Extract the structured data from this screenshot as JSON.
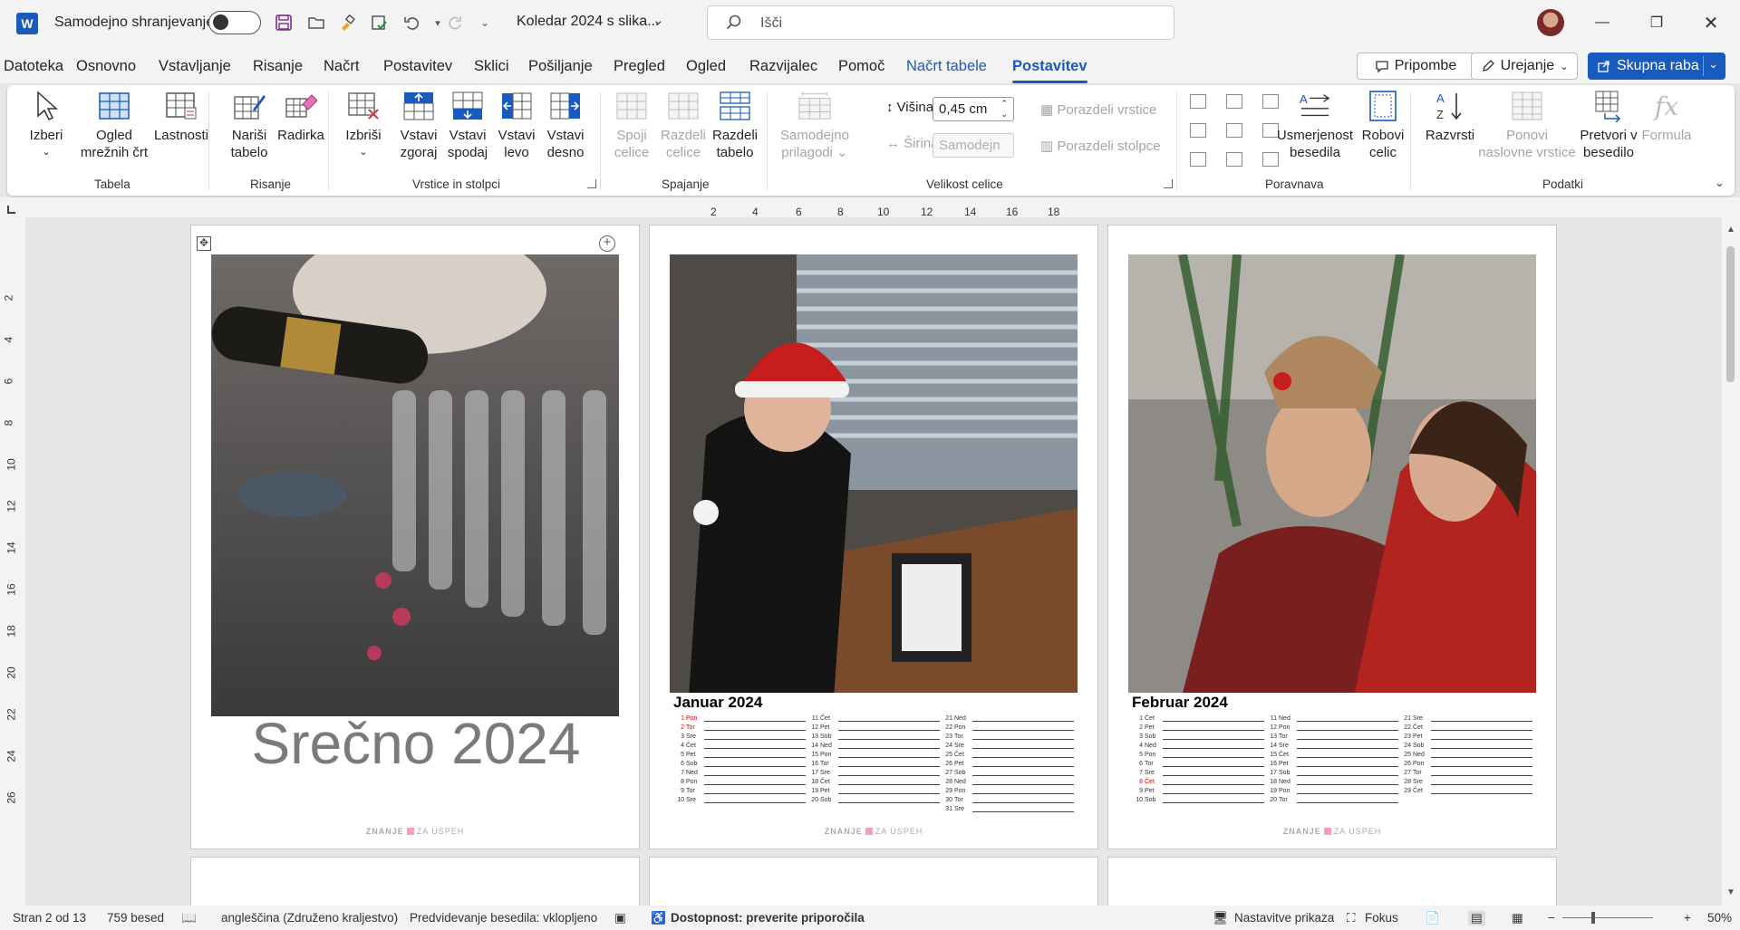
{
  "titlebar": {
    "app_logo": "W",
    "autosave_label": "Samodejno shranjevanje",
    "doc_title": "Koledar 2024 s slika...",
    "search_placeholder": "Išči",
    "icons": [
      "save-icon",
      "open-folder-icon",
      "format-painter-icon",
      "check-icon",
      "undo-icon",
      "redo-icon",
      "more-icon"
    ]
  },
  "menu": {
    "tabs": [
      "Datoteka",
      "Osnovno",
      "Vstavljanje",
      "Risanje",
      "Načrt",
      "Postavitev",
      "Sklici",
      "Pošiljanje",
      "Pregled",
      "Ogled",
      "Razvijalec",
      "Pomoč"
    ],
    "context_tabs": [
      "Načrt tabele",
      "Postavitev"
    ],
    "comments": "Pripombe",
    "editing": "Urejanje",
    "share": "Skupna raba",
    "accent": "#185abd"
  },
  "ribbon": {
    "groups": {
      "table": "Tabela",
      "draw": "Risanje",
      "rows_cols": "Vrstice in stolpci",
      "merge": "Spajanje",
      "cell_size": "Velikost celice",
      "alignment": "Poravnava",
      "data": "Podatki"
    },
    "buttons": {
      "select": "Izberi",
      "gridlines1": "Ogled",
      "gridlines2": "mrežnih črt",
      "properties": "Lastnosti",
      "draw1": "Nariši",
      "draw2": "tabelo",
      "eraser": "Radirka",
      "delete": "Izbriši",
      "ins_above1": "Vstavi",
      "ins_above2": "zgoraj",
      "ins_below1": "Vstavi",
      "ins_below2": "spodaj",
      "ins_left1": "Vstavi",
      "ins_left2": "levo",
      "ins_right1": "Vstavi",
      "ins_right2": "desno",
      "merge1": "Spoji",
      "merge2": "celice",
      "split_cells1": "Razdeli",
      "split_cells2": "celice",
      "split_table1": "Razdeli",
      "split_table2": "tabelo",
      "autofit1": "Samodejno",
      "autofit2": "prilagodi",
      "height_label": "Višina:",
      "height_value": "0,45 cm",
      "width_label": "Širina:",
      "width_value": "Samodejn",
      "dist_rows": "Porazdeli vrstice",
      "dist_cols": "Porazdeli stolpce",
      "text_dir1": "Usmerjenost",
      "text_dir2": "besedila",
      "margins1": "Robovi",
      "margins2": "celic",
      "sort": "Razvrsti",
      "repeat1": "Ponovi",
      "repeat2": "naslovne vrstice",
      "convert1": "Pretvori v",
      "convert2": "besedilo",
      "formula": "Formula"
    }
  },
  "ruler": {
    "h_numbers": [
      "2",
      "4",
      "6",
      "8",
      "10",
      "12",
      "14",
      "16",
      "18"
    ],
    "v_numbers": [
      "2",
      "4",
      "6",
      "8",
      "10",
      "12",
      "14",
      "16",
      "18",
      "20",
      "22",
      "24",
      "26"
    ]
  },
  "pages": {
    "cover_text": "Srečno 2024",
    "january_title": "Januar 2024",
    "february_title": "Februar 2024",
    "footer_brand": "ZNANJE",
    "footer_brand2": "ZA USPEH",
    "january": {
      "col1": [
        [
          "1",
          "Pon",
          true
        ],
        [
          "2",
          "Tor",
          true
        ],
        [
          "3",
          "Sre",
          false
        ],
        [
          "4",
          "Čet",
          false
        ],
        [
          "5",
          "Pet",
          false
        ],
        [
          "6",
          "Sob",
          false
        ],
        [
          "7",
          "Ned",
          false
        ],
        [
          "8",
          "Pon",
          false
        ],
        [
          "9",
          "Tor",
          false
        ],
        [
          "10",
          "Sre",
          false
        ]
      ],
      "col2": [
        [
          "11",
          "Čet",
          false
        ],
        [
          "12",
          "Pet",
          false
        ],
        [
          "13",
          "Sob",
          false
        ],
        [
          "14",
          "Ned",
          false
        ],
        [
          "15",
          "Pon",
          false
        ],
        [
          "16",
          "Tor",
          false
        ],
        [
          "17",
          "Sre",
          false
        ],
        [
          "18",
          "Čet",
          false
        ],
        [
          "19",
          "Pet",
          false
        ],
        [
          "20",
          "Sob",
          false
        ]
      ],
      "col3": [
        [
          "21",
          "Ned",
          false
        ],
        [
          "22",
          "Pon",
          false
        ],
        [
          "23",
          "Tor",
          false
        ],
        [
          "24",
          "Sre",
          false
        ],
        [
          "25",
          "Čet",
          false
        ],
        [
          "26",
          "Pet",
          false
        ],
        [
          "27",
          "Sob",
          false
        ],
        [
          "28",
          "Ned",
          false
        ],
        [
          "29",
          "Pon",
          false
        ],
        [
          "30",
          "Tor",
          false
        ],
        [
          "31",
          "Sre",
          false
        ]
      ]
    },
    "february": {
      "col1": [
        [
          "1",
          "Čet",
          false
        ],
        [
          "2",
          "Pet",
          false
        ],
        [
          "3",
          "Sob",
          false
        ],
        [
          "4",
          "Ned",
          false
        ],
        [
          "5",
          "Pon",
          false
        ],
        [
          "6",
          "Tor",
          false
        ],
        [
          "7",
          "Sre",
          false
        ],
        [
          "8",
          "Čet",
          true
        ],
        [
          "9",
          "Pet",
          false
        ],
        [
          "10",
          "Sob",
          false
        ]
      ],
      "col2": [
        [
          "11",
          "Ned",
          false
        ],
        [
          "12",
          "Pon",
          false
        ],
        [
          "13",
          "Tor",
          false
        ],
        [
          "14",
          "Sre",
          false
        ],
        [
          "15",
          "Čet",
          false
        ],
        [
          "16",
          "Pet",
          false
        ],
        [
          "17",
          "Sob",
          false
        ],
        [
          "18",
          "Ned",
          false
        ],
        [
          "19",
          "Pon",
          false
        ],
        [
          "20",
          "Tor",
          false
        ]
      ],
      "col3": [
        [
          "21",
          "Sre",
          false
        ],
        [
          "22",
          "Čet",
          false
        ],
        [
          "23",
          "Pet",
          false
        ],
        [
          "24",
          "Sob",
          false
        ],
        [
          "25",
          "Ned",
          false
        ],
        [
          "26",
          "Pon",
          false
        ],
        [
          "27",
          "Tor",
          false
        ],
        [
          "28",
          "Sre",
          false
        ],
        [
          "29",
          "Čet",
          false
        ]
      ]
    }
  },
  "status": {
    "page": "Stran 2 od 13",
    "words": "759 besed",
    "language": "angleščina (Združeno kraljestvo)",
    "prediction": "Predvidevanje besedila: vklopljeno",
    "accessibility": "Dostopnost: preverite priporočila",
    "display_settings": "Nastavitve prikaza",
    "focus": "Fokus",
    "zoom": "50%"
  }
}
